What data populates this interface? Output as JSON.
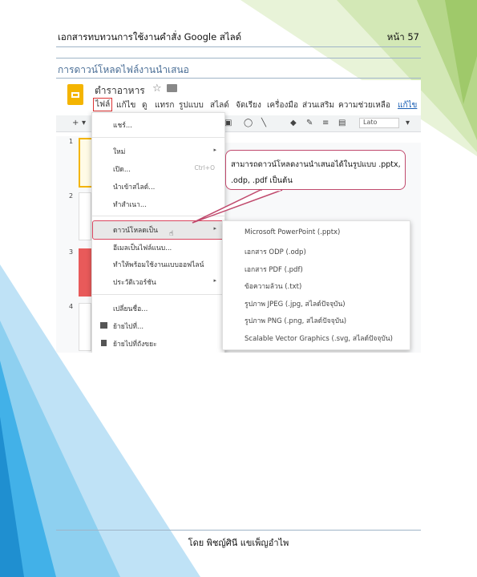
{
  "header": {
    "doc_title": "เอกสารทบทวนการใช้งานคำสั่ง Google สไลด์",
    "page_number": "หน้า 57"
  },
  "section": {
    "title": "การดาวน์โหลดไฟล์งานนำเสนอ"
  },
  "app": {
    "doc_name": "ตำราอาหาร",
    "menubar": [
      "ไฟล์",
      "แก้ไข",
      "ดู",
      "แทรก",
      "รูปแบบ",
      "สไลด์",
      "จัดเรียง",
      "เครื่องมือ",
      "ส่วนเสริม",
      "ความช่วยเหลือ",
      "แก้ไข"
    ],
    "font_box": "Lato",
    "slide_numbers": [
      "1",
      "2",
      "3",
      "4"
    ]
  },
  "file_menu": {
    "items": [
      {
        "label": "แชร์...",
        "shortcut": "",
        "arrow": false
      },
      {
        "label": "ใหม่",
        "shortcut": "",
        "arrow": true
      },
      {
        "label": "เปิด...",
        "shortcut": "Ctrl+O",
        "arrow": false
      },
      {
        "label": "นำเข้าสไลด์...",
        "shortcut": "",
        "arrow": false
      },
      {
        "label": "ทำสำเนา...",
        "shortcut": "",
        "arrow": false
      },
      {
        "label": "ดาวน์โหลดเป็น",
        "shortcut": "",
        "arrow": true
      },
      {
        "label": "อีเมลเป็นไฟล์แนบ...",
        "shortcut": "",
        "arrow": false
      },
      {
        "label": "ทำให้พร้อมใช้งานแบบออฟไลน์",
        "shortcut": "",
        "arrow": false
      },
      {
        "label": "ประวัติเวอร์ชัน",
        "shortcut": "",
        "arrow": true
      },
      {
        "label": "เปลี่ยนชื่อ...",
        "shortcut": "",
        "arrow": false
      },
      {
        "label": "ย้ายไปที่...",
        "shortcut": "",
        "arrow": false
      },
      {
        "label": "ย้ายไปที่ถังขยะ",
        "shortcut": "",
        "arrow": false
      }
    ]
  },
  "download_submenu": {
    "items": [
      "Microsoft PowerPoint (.pptx)",
      "เอกสาร ODP (.odp)",
      "เอกสาร PDF (.pdf)",
      "ข้อความล้วน (.txt)",
      "รูปภาพ JPEG (.jpg, สไลด์ปัจจุบัน)",
      "รูปภาพ PNG (.png, สไลด์ปัจจุบัน)",
      "Scalable Vector Graphics (.svg, สไลด์ปัจจุบัน)"
    ]
  },
  "callout": {
    "text": "สามารถดาวน์โหลดงานนำเสนอได้ในรูปแบบ .pptx, .odp, .pdf เป็นต้น"
  },
  "footer": {
    "author": "โดย พิชญ์ศินี แขเพ็ญอำไพ"
  },
  "colors": {
    "accent_blue": "#4a6e96",
    "highlight_border": "#d9455f",
    "slides_yellow": "#f4b400"
  }
}
